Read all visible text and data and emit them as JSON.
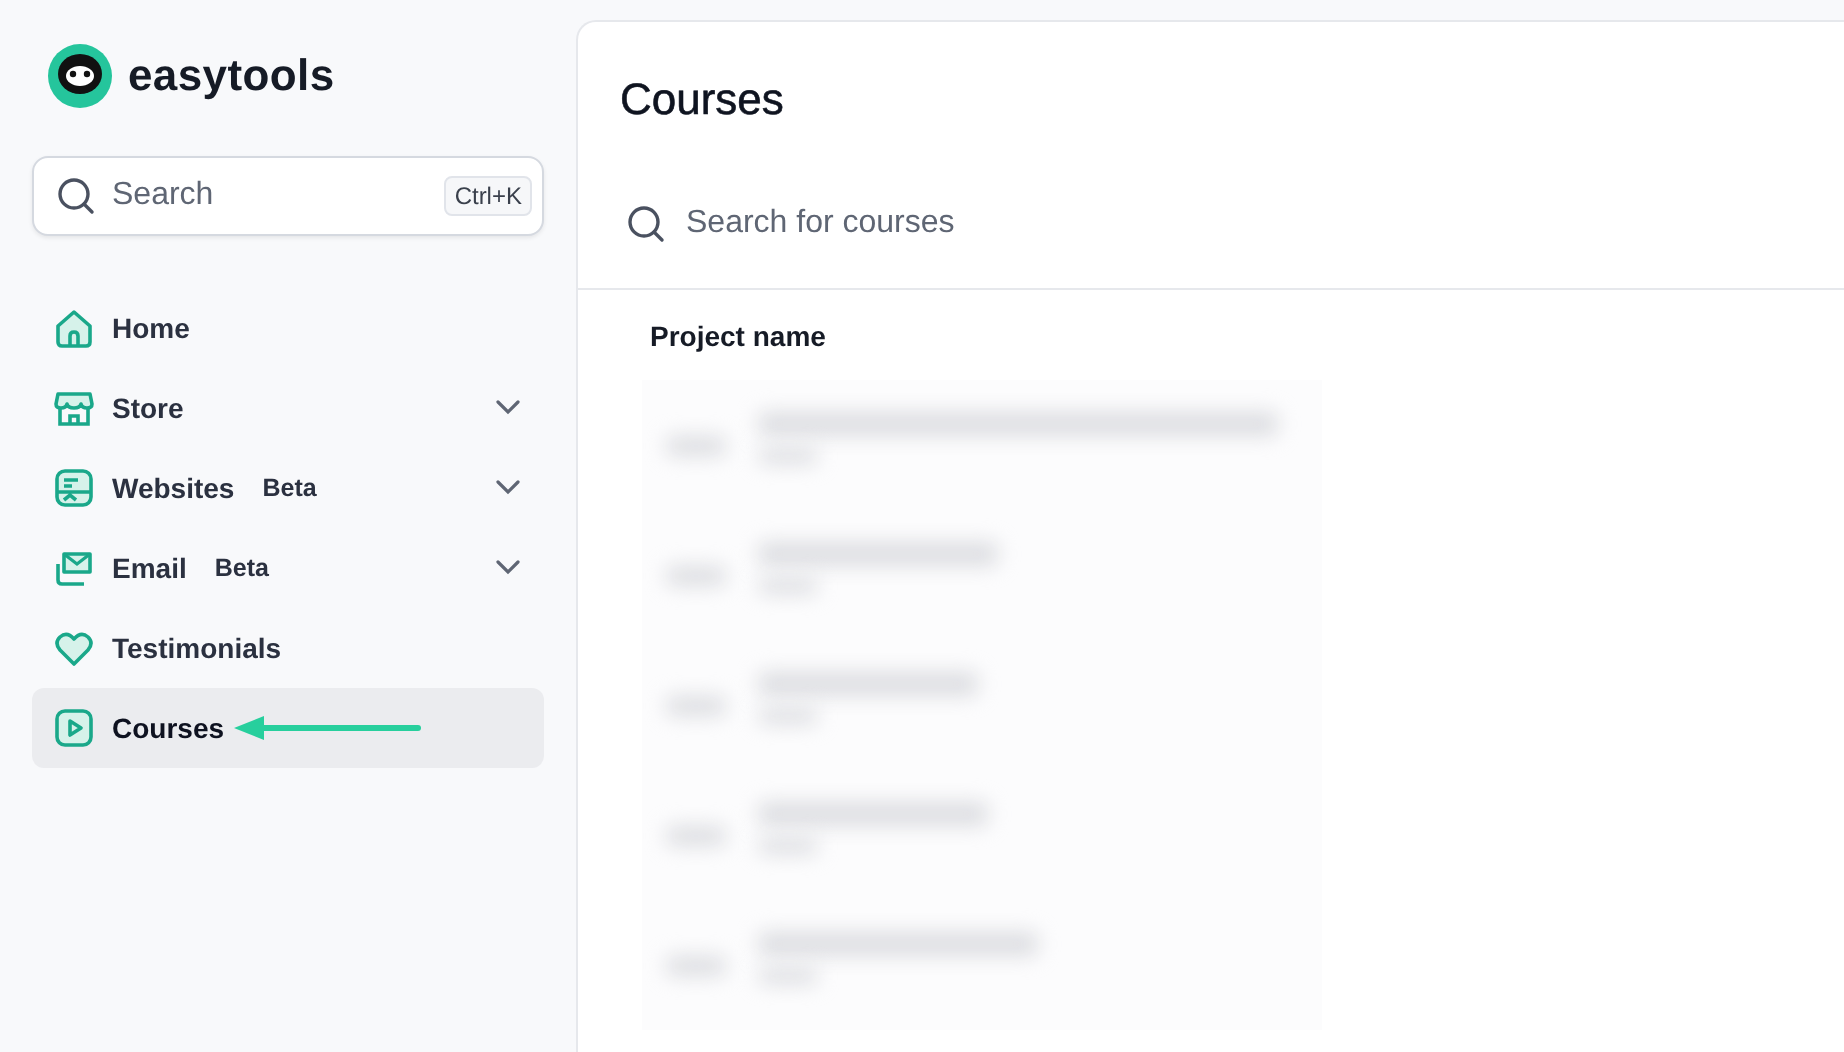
{
  "brand": {
    "name": "easytools"
  },
  "search": {
    "placeholder": "Search",
    "shortcut": "Ctrl+K"
  },
  "nav": [
    {
      "kind": "home",
      "label": "Home",
      "expandable": false,
      "selected": false,
      "arrow": false
    },
    {
      "kind": "store",
      "label": "Store",
      "expandable": true,
      "selected": false,
      "arrow": false
    },
    {
      "kind": "websites",
      "label": "Websites",
      "badge": "Beta",
      "expandable": true,
      "selected": false,
      "arrow": false
    },
    {
      "kind": "email",
      "label": "Email",
      "badge": "Beta",
      "expandable": true,
      "selected": false,
      "arrow": false
    },
    {
      "kind": "testimonials",
      "label": "Testimonials",
      "expandable": false,
      "selected": false,
      "arrow": false
    },
    {
      "kind": "courses",
      "label": "Courses",
      "expandable": false,
      "selected": true,
      "arrow": true
    }
  ],
  "page": {
    "title": "Courses",
    "search": {
      "placeholder": "Search for courses"
    },
    "table": {
      "columns": [
        "Project name"
      ],
      "rows": [
        {
          "kind": "blurred"
        },
        {
          "kind": "blurred"
        },
        {
          "kind": "blurred"
        },
        {
          "kind": "blurred"
        },
        {
          "kind": "blurred"
        }
      ]
    }
  }
}
